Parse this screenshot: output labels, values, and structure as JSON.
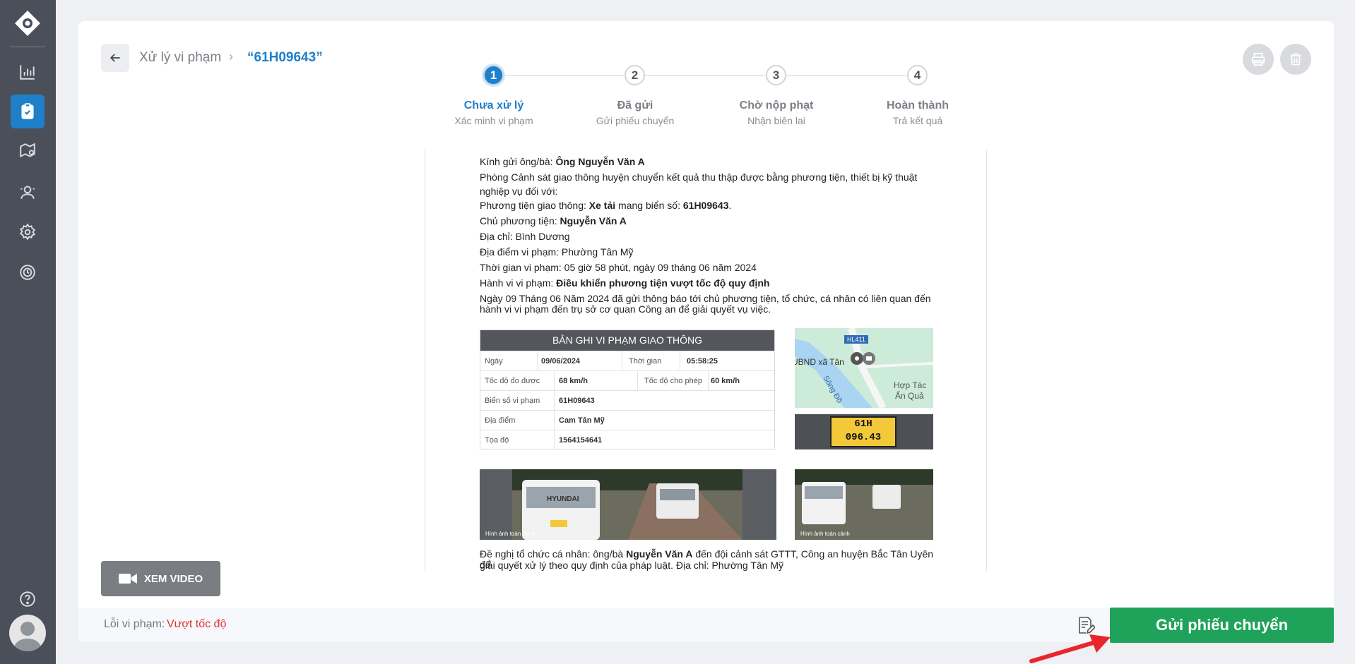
{
  "header": {
    "breadcrumb": "Xử lý vi phạm",
    "record_id": "“61H09643”"
  },
  "steps": [
    {
      "num": "1",
      "title": "Chưa xử lý",
      "subtitle": "Xác minh vi phạm"
    },
    {
      "num": "2",
      "title": "Đã gửi",
      "subtitle": "Gửi phiếu chuyển"
    },
    {
      "num": "3",
      "title": "Chờ nộp phạt",
      "subtitle": "Nhận biên lai"
    },
    {
      "num": "4",
      "title": "Hoàn thành",
      "subtitle": "Trả kết quả"
    }
  ],
  "document": {
    "greeting_label": "Kính gửi ông/bà:",
    "greeting_name": "Ông Nguyễn Văn A",
    "intro_1": "Phòng Cảnh sát giao thông huyện chuyển kết quả thu thập được bằng phương tiện, thiết bị kỹ thuật",
    "intro_2": "nghiệp vụ đối với:",
    "vehicle_label": "Phương tiện giao thông:",
    "vehicle_type": "Xe tải",
    "plate_label": "mang biển số:",
    "plate": "61H09643",
    "period": ".",
    "owner_label": "Chủ phương tiện:",
    "owner": "Nguyễn Văn A",
    "address": "Địa chỉ: Bình Dương",
    "location": "Địa điểm vi phạm: Phường Tân Mỹ",
    "time": "Thời gian vi phạm: 05 giờ 58 phút, ngày 09 tháng 06 năm 2024",
    "behavior_label": "Hành vi vi phạm:",
    "behavior": "Điều khiển phương tiện vượt tốc độ quy định",
    "notice_1": "Ngày 09 Tháng 06 Năm 2024 đã gửi thông báo tới chủ phương tiện, tổ chức, cá nhân có liên quan đến",
    "notice_2": "hành vi vi phạm đến trụ sở cơ quan Công an để giải quyết vụ việc.",
    "closing_a": "Đề nghị tổ chức cá nhân: ông/bà",
    "closing_name": "Nguyễn Văn A",
    "closing_b": "đến đội cảnh sát GTTT, Công an huyện Bắc Tân Uyên để",
    "closing_2": "giải quyết xử lý theo quy định của pháp luật. Địa chỉ: Phường Tân Mỹ"
  },
  "record": {
    "title": "BẢN GHI VI PHẠM GIAO THÔNG",
    "date_label": "Ngày",
    "date": "09/06/2024",
    "time_label": "Thời gian",
    "time": "05:58:25",
    "speed_label": "Tốc độ đo được",
    "speed": "68 km/h",
    "limit_label": "Tốc độ cho phép",
    "limit": "60 km/h",
    "plate_label": "Biển số vi phạm",
    "plate": "61H09643",
    "place_label": "Địa điểm",
    "place": "Cam Tân Mỹ",
    "coord_label": "Tọa độ",
    "coord": "1564154641"
  },
  "map": {
    "road": "HL411",
    "poi": "UBND xã Tân",
    "river": "Sông Đồ",
    "area_1": "Hợp Tác",
    "area_2": "Ấn Quả"
  },
  "plate_image": {
    "line1": "61H",
    "line2": "096.43"
  },
  "pano_caption": "Hình ảnh toàn cảnh",
  "truck_brand": "HYUNDAI",
  "video_button": "XEM VIDEO",
  "footer": {
    "error_label": "Lỗi vi phạm:",
    "error_value": "Vượt tốc độ",
    "send_button": "Gửi phiếu chuyển"
  },
  "colors": {
    "primary": "#1f7fc9",
    "success": "#1fa35a",
    "danger": "#e03030",
    "sidebar": "#4a4f5a"
  },
  "icons": [
    "logo-icon",
    "chart-icon",
    "clipboard-check-icon",
    "map-pin-icon",
    "users-icon",
    "gear-icon",
    "clock-icon",
    "help-icon",
    "user-avatar-icon",
    "arrow-left-icon",
    "printer-icon",
    "trash-icon",
    "video-icon",
    "note-edit-icon"
  ]
}
